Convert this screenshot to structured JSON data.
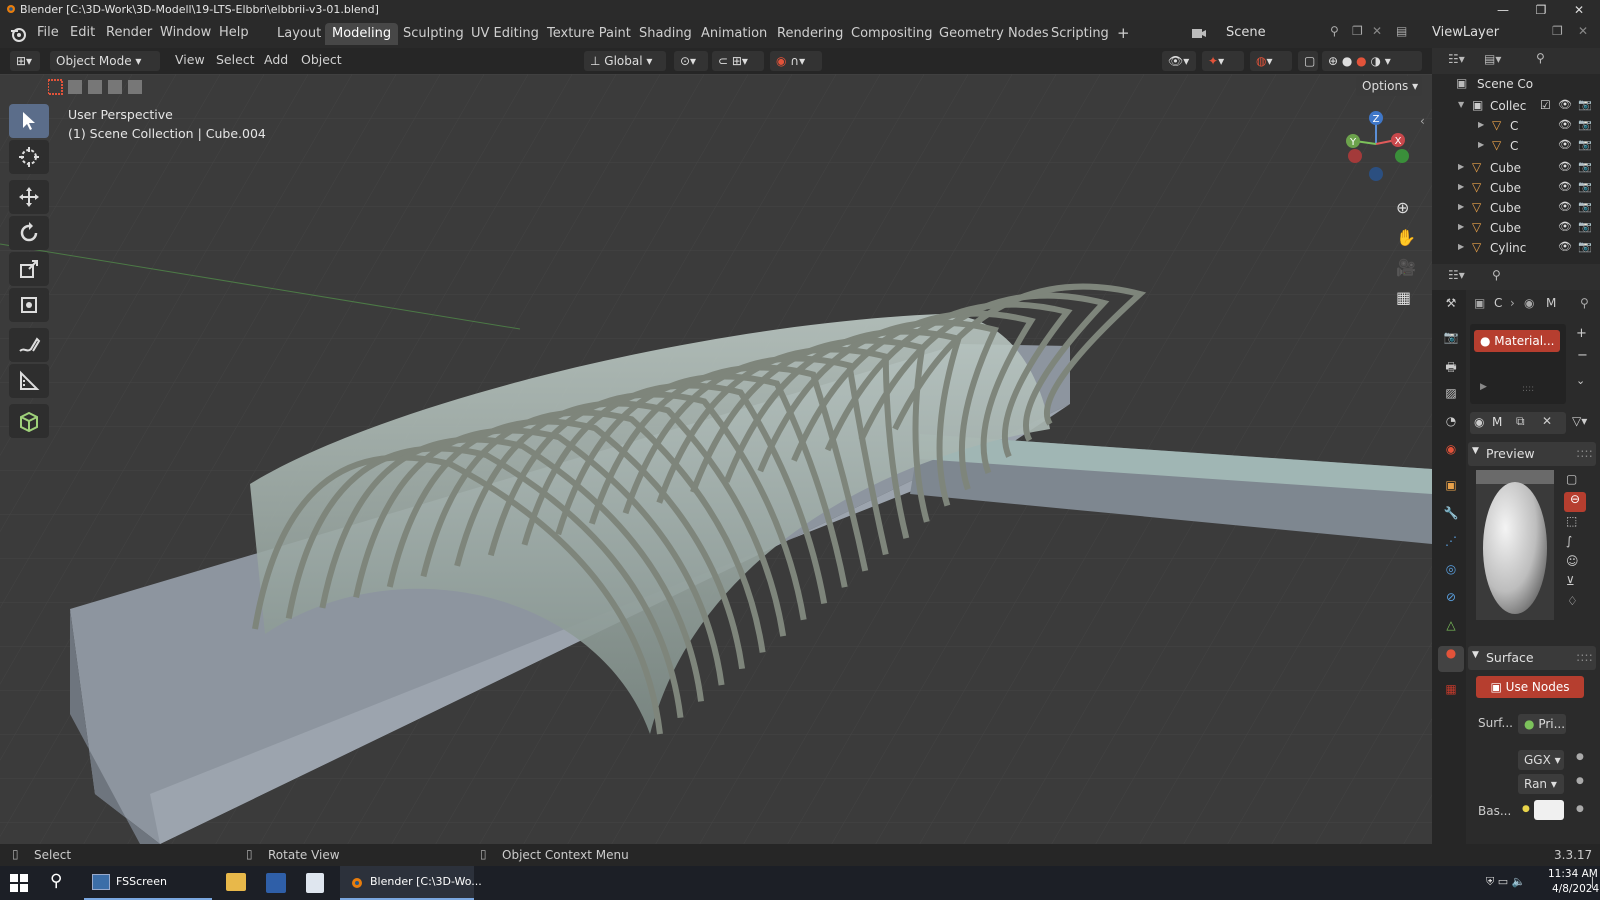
{
  "window": {
    "title": "Blender [C:\\3D-Work\\3D-Modell\\19-LTS-Elbbri\\elbbrii-v3-01.blend]",
    "minimize": "—",
    "maximize": "❐",
    "close": "✕"
  },
  "menus": [
    "File",
    "Edit",
    "Render",
    "Window",
    "Help"
  ],
  "workspaces": [
    {
      "label": "Layout",
      "active": false
    },
    {
      "label": "Modeling",
      "active": true
    },
    {
      "label": "Sculpting",
      "active": false
    },
    {
      "label": "UV Editing",
      "active": false
    },
    {
      "label": "Texture Paint",
      "active": false
    },
    {
      "label": "Shading",
      "active": false
    },
    {
      "label": "Animation",
      "active": false
    },
    {
      "label": "Rendering",
      "active": false
    },
    {
      "label": "Compositing",
      "active": false
    },
    {
      "label": "Geometry Nodes",
      "active": false
    },
    {
      "label": "Scripting",
      "active": false
    }
  ],
  "add_workspace": "+",
  "scene": {
    "name": "Scene"
  },
  "view_layer": {
    "name": "ViewLayer"
  },
  "header3d": {
    "mode": "Object Mode",
    "menus": [
      "View",
      "Select",
      "Add",
      "Object"
    ],
    "orientation": "Global",
    "options": "Options"
  },
  "viewport": {
    "perspective": "User Perspective",
    "collection_info": "(1) Scene Collection | Cube.004",
    "gizmo": {
      "z": "Z",
      "y": "Y",
      "x": "X"
    }
  },
  "outliner": {
    "root": "Scene Co",
    "rows": [
      {
        "name": "Collec",
        "type": "collection"
      },
      {
        "name": "C",
        "type": "mesh"
      },
      {
        "name": "C",
        "type": "mesh"
      },
      {
        "name": "Cube",
        "type": "mesh"
      },
      {
        "name": "Cube",
        "type": "mesh"
      },
      {
        "name": "Cube",
        "type": "mesh"
      },
      {
        "name": "Cube",
        "type": "mesh"
      },
      {
        "name": "Cylinc",
        "type": "mesh"
      }
    ]
  },
  "properties": {
    "breadcrumb_c": "C",
    "breadcrumb_m": "M",
    "material_slot": "Material...",
    "material_name": "M",
    "preview_label": "Preview",
    "surface_label": "Surface",
    "use_nodes": "Use Nodes",
    "surf_label": "Surf...",
    "surf_value": "Pri...",
    "ggx": "GGX",
    "ran": "Ran",
    "bas_label": "Bas..."
  },
  "statusbar": {
    "select": "Select",
    "rotate": "Rotate View",
    "context": "Object Context Menu",
    "version": "3.3.17"
  },
  "taskbar": {
    "apps": [
      "FSScreen",
      "Blender [C:\\3D-Wo..."
    ],
    "time": "11:34 AM",
    "date": "4/8/2024"
  },
  "colors": {
    "accent": "#e2533a",
    "active_tool": "#5b6d8a",
    "viewport_bg": "#3b3b3b"
  }
}
